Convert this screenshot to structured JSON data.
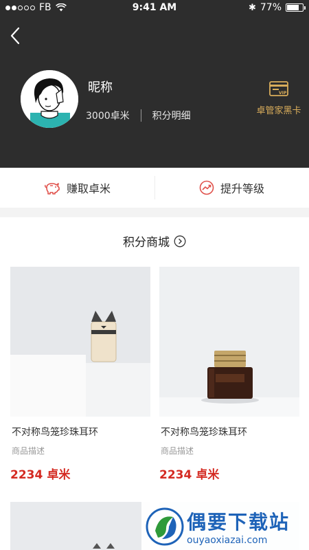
{
  "status_bar": {
    "carrier": "FB",
    "time": "9:41 AM",
    "battery": "77%",
    "battery_level": 0.77
  },
  "profile": {
    "nickname": "昵称",
    "points": "3000卓米",
    "points_detail": "积分明细",
    "vip_card_label": "卓管家黑卡",
    "vip_badge": "VIP"
  },
  "actions": {
    "earn_label": "赚取卓米",
    "upgrade_label": "提升等级"
  },
  "mall": {
    "title": "积分商城",
    "products": [
      {
        "name": "不对称鸟笼珍珠耳环",
        "desc": "商品描述",
        "price": "2234",
        "unit": "卓米"
      },
      {
        "name": "不对称鸟笼珍珠耳环",
        "desc": "商品描述",
        "price": "2234",
        "unit": "卓米"
      }
    ]
  },
  "watermark": {
    "name": "偶要下载站",
    "url": "ouyaoxiazai.com"
  },
  "colors": {
    "header_bg": "#2d2d2d",
    "accent_gold": "#d9ad5b",
    "price_red": "#d42a22",
    "icon_red": "#e0504a"
  }
}
